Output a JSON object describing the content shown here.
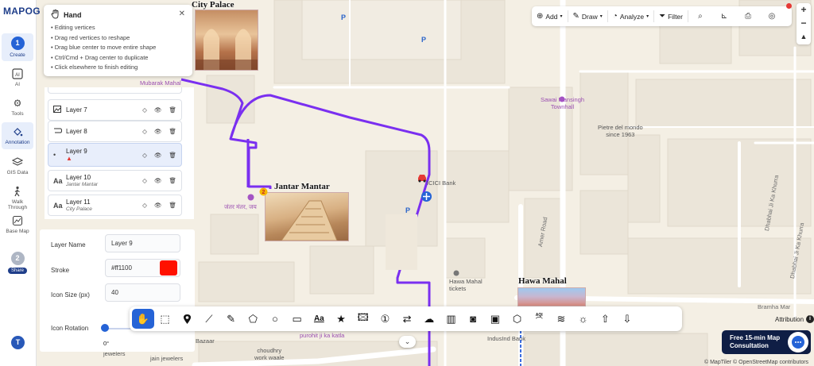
{
  "app": {
    "logo_text": "MAPOG",
    "collapse_icon": "chevron-right-icon"
  },
  "sidebar": {
    "items": [
      {
        "label": "Create",
        "step": "1",
        "active": true
      },
      {
        "label": "AI",
        "icon": "ai-icon"
      },
      {
        "label": "Tools",
        "icon": "gear-icon"
      },
      {
        "label": "Annotation",
        "icon": "paint-bucket-icon",
        "active": true
      },
      {
        "label": "GIS Data",
        "icon": "layers-icon"
      },
      {
        "label": "Walk Through",
        "icon": "walk-icon"
      },
      {
        "label": "Base Map",
        "icon": "basemap-icon"
      },
      {
        "label": "Share",
        "step": "2"
      }
    ],
    "user_initial": "T"
  },
  "hand_tooltip": {
    "title": "Hand",
    "lines": [
      "• Editing vertices",
      "• Drag red vertices to reshape",
      "• Drag blue center to move entire shape",
      "• Ctrl/Cmd + Drag center to duplicate",
      "• Click elsewhere to finish editing"
    ]
  },
  "layers": [
    {
      "name": "Layer 7",
      "subtitle": "",
      "icon": "image-icon"
    },
    {
      "name": "Layer 8",
      "subtitle": "",
      "icon": "route-icon"
    },
    {
      "name": "Layer 9",
      "subtitle": "",
      "icon": "car-icon",
      "selected": true
    },
    {
      "name": "Layer 10",
      "subtitle": "Jantar Mantar",
      "icon": "text-icon"
    },
    {
      "name": "Layer 11",
      "subtitle": "City Palace",
      "icon": "text-icon"
    }
  ],
  "properties": {
    "layer_name_label": "Layer Name",
    "layer_name_value": "Layer 9",
    "stroke_label": "Stroke",
    "stroke_value": "#ff1100",
    "icon_size_label": "Icon Size (px)",
    "icon_size_value": "40",
    "icon_rotation_label": "Icon Rotation",
    "icon_rotation_value": "0°",
    "icon_rotation_degrees": 0
  },
  "topbar": {
    "add_label": "Add",
    "draw_label": "Draw",
    "analyze_label": "Analyze",
    "filter_label": "Filter",
    "icons": [
      "search-icon",
      "measure-icon",
      "print-icon",
      "locate-icon"
    ]
  },
  "zoom": {
    "in": "+",
    "out": "−"
  },
  "dock_tools": [
    "hand-icon",
    "select-icon",
    "pin-icon",
    "line-icon",
    "pen-icon",
    "polygon-icon",
    "circle-icon",
    "rectangle-icon",
    "text-icon",
    "star-icon",
    "image-icon",
    "number-icon",
    "route-icon",
    "freehand-shape-icon",
    "building-icon",
    "camera-icon",
    "photo-icon",
    "cube-icon",
    "aqi-icon",
    "wind-icon",
    "weather-icon",
    "upload-icon",
    "download-icon"
  ],
  "dock_aqi_label": "AQI",
  "map": {
    "labels": {
      "city_palace": "City Palace",
      "jantar_mantar": "Jantar Mantar",
      "hawa_mahal": "Hawa Mahal",
      "mubarak_mahal": "Mubarak Mahal",
      "sawai_mansingh": "Sawai Mansingh\nTownhall",
      "pietre": "Pietre del mondo\nsince 1963",
      "icici": "ICICI Bank",
      "hawa_tickets": "Hawa Mahal\ntickets",
      "indusind": "IndusInd Bank",
      "amer_road": "Amer Road",
      "dhabhai_1": "Dhabhai Ji Ka Khurra",
      "dhabhai_2": "Dhabhai Ji Ka Khurra",
      "bramha": "Bramha Mar",
      "purohit": "purohit ji ka katla",
      "choudhry": "choudhry\nwork waale",
      "jain_jewelers": "jain jewelers",
      "jewelers": "jewelers",
      "bazaar": "Bazaar",
      "jantar_hindi": "जंतर मंतर, जय"
    },
    "parking": "P",
    "vehicle_color": "#e53935",
    "route_color": "#7a2ff0"
  },
  "attribution": {
    "label": "Attribution",
    "info": "i"
  },
  "consultation": {
    "line1": "Free 15-min Map",
    "line2": "Consultation"
  },
  "copyright": "© MapTiler © OpenStreetMap contributors"
}
